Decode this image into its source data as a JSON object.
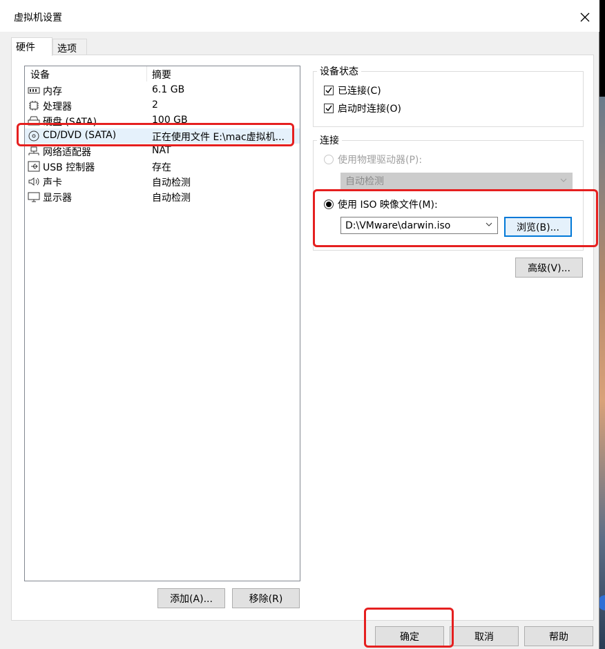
{
  "window": {
    "title": "虚拟机设置"
  },
  "tabs": [
    {
      "label": "硬件"
    },
    {
      "label": "选项"
    }
  ],
  "device_list": {
    "headers": {
      "device": "设备",
      "summary": "摘要"
    },
    "rows": [
      {
        "name": "内存",
        "summary": "6.1 GB",
        "icon": "memory-icon"
      },
      {
        "name": "处理器",
        "summary": "2",
        "icon": "processor-icon"
      },
      {
        "name": "硬盘 (SATA)",
        "summary": "100 GB",
        "icon": "hard-disk-icon"
      },
      {
        "name": "CD/DVD (SATA)",
        "summary": "正在使用文件 E:\\mac虚拟机...",
        "icon": "cd-dvd-icon",
        "selected": true
      },
      {
        "name": "网络适配器",
        "summary": "NAT",
        "icon": "network-adapter-icon"
      },
      {
        "name": "USB 控制器",
        "summary": "存在",
        "icon": "usb-icon"
      },
      {
        "name": "声卡",
        "summary": "自动检测",
        "icon": "speaker-icon"
      },
      {
        "name": "显示器",
        "summary": "自动检测",
        "icon": "monitor-icon"
      }
    ],
    "add_button": "添加(A)...",
    "remove_button": "移除(R)"
  },
  "device_status": {
    "title": "设备状态",
    "connected": {
      "label": "已连接(C)",
      "checked": true
    },
    "connect_at_power_on": {
      "label": "启动时连接(O)",
      "checked": true
    }
  },
  "connection": {
    "title": "连接",
    "physical_drive": {
      "label": "使用物理驱动器(P):",
      "selected": false,
      "enabled": false,
      "value": "自动检测"
    },
    "iso_image": {
      "label": "使用 ISO 映像文件(M):",
      "selected": true,
      "value": "D:\\VMware\\darwin.iso"
    },
    "browse_button": "浏览(B)...",
    "advanced_button": "高级(V)..."
  },
  "footer": {
    "ok": "确定",
    "cancel": "取消",
    "help": "帮助"
  },
  "colors": {
    "accent": "#0078d7",
    "highlight_annotation": "#e51f1f",
    "selected_row": "#e5f1fb"
  }
}
